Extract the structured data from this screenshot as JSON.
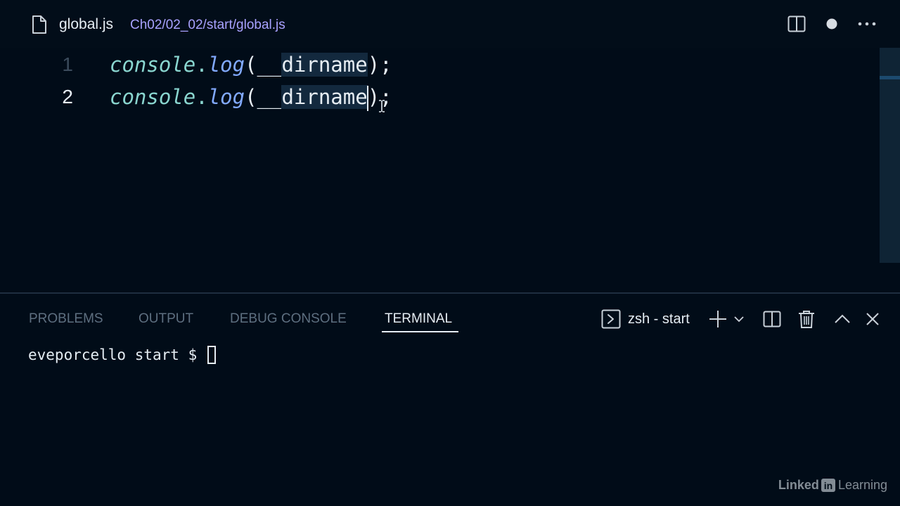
{
  "editor_tab": {
    "file_name": "global.js",
    "file_path": "Ch02/02_02/start/global.js",
    "actions": {
      "split_editor": "split-editor-icon",
      "unsaved_indicator": "dot-icon",
      "more": "ellipsis-icon"
    }
  },
  "editor": {
    "lines": [
      {
        "number": "1",
        "active": false,
        "tokens": {
          "object": "console",
          "dot": ".",
          "method": "log",
          "open_paren": "(",
          "argument_prefix": "__",
          "argument": "dirname",
          "close": ");"
        }
      },
      {
        "number": "2",
        "active": true,
        "tokens": {
          "object": "console",
          "dot": ".",
          "method": "log",
          "open_paren": "(",
          "argument_prefix": "__",
          "argument": "dirname",
          "close": ");"
        }
      }
    ]
  },
  "panel": {
    "tabs": [
      {
        "label": "PROBLEMS",
        "active": false
      },
      {
        "label": "OUTPUT",
        "active": false
      },
      {
        "label": "DEBUG CONSOLE",
        "active": false
      },
      {
        "label": "TERMINAL",
        "active": true
      }
    ],
    "terminal_picker_label": "zsh - start",
    "terminal": {
      "prompt": "eveporcello start $ "
    }
  },
  "watermark": {
    "part1": "Linked",
    "part2": "in",
    "part3": " Learning"
  },
  "colors": {
    "background": "#010c18",
    "keyword_object": "#8ad6d0",
    "method": "#82aaff",
    "file_path": "#a9a2ff",
    "selection_highlight": "#13293e"
  }
}
